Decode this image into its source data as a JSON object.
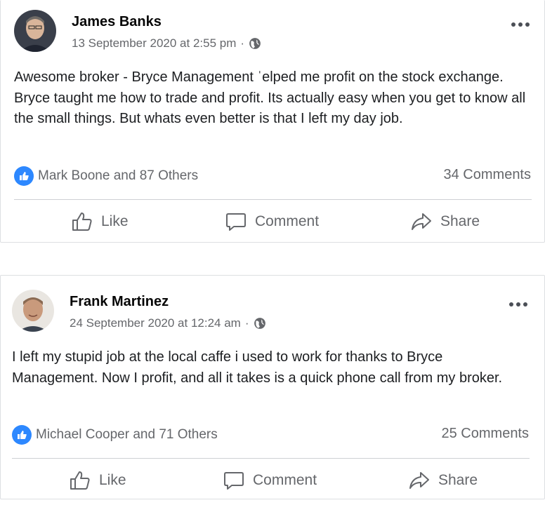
{
  "posts": [
    {
      "author": "James Banks",
      "timestamp": "13 September 2020 at 2:55 pm",
      "separator": "·",
      "privacy_icon": "globe-icon",
      "text": "Awesome broker - Bryce Management ˈelped me profit on the stock exchange. Bryce taught me how to trade and profit. Its actually easy when you get to know all the small things. But whats even better is that I left my day job.",
      "reactions": "Mark Boone and 87 Others",
      "comments": "34 Comments",
      "actions": {
        "like": "Like",
        "comment": "Comment",
        "share": "Share"
      }
    },
    {
      "author": "Frank Martinez",
      "timestamp": "24 September 2020 at 12:24 am",
      "separator": "·",
      "privacy_icon": "globe-icon",
      "text": "I left my stupid job at the local caffe i used to work for thanks to Bryce Management. Now I profit, and all it takes is a quick phone call from my broker.",
      "reactions": "Michael Cooper and 71 Others",
      "comments": "25 Comments",
      "actions": {
        "like": "Like",
        "comment": "Comment",
        "share": "Share"
      }
    }
  ],
  "colors": {
    "like_blue": "#2d88ff",
    "secondary_text": "#65676b",
    "divider": "#ced0d4"
  }
}
